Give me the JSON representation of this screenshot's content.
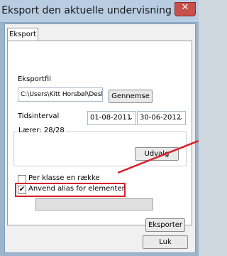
{
  "window": {
    "title": "Eksport den aktuelle undervisning",
    "close_glyph": "✕"
  },
  "tabs": [
    {
      "label": "Eksport"
    }
  ],
  "eksportfil": {
    "label": "Eksportfil",
    "path_value": "C:\\Users\\Kitt Horsbøl\\Desk",
    "browse_label": "Gennemse"
  },
  "tidsinterval": {
    "label": "Tidsinterval",
    "from_value": "01-08-2011",
    "to_value": "30-06-2012",
    "arrow": "⌄"
  },
  "laerer": {
    "caption": "Lærer: 28/28",
    "select_label": "Udvalg"
  },
  "options": [
    {
      "label": "Per klasse en række",
      "checked": false
    },
    {
      "label": "Anvend alias for elementer",
      "checked": true,
      "check_glyph": "✔"
    }
  ],
  "progress": {
    "value": 0
  },
  "actions": {
    "export_label": "Eksporter",
    "close_label": "Luk"
  },
  "annotation": {
    "color": "#d8212a"
  }
}
